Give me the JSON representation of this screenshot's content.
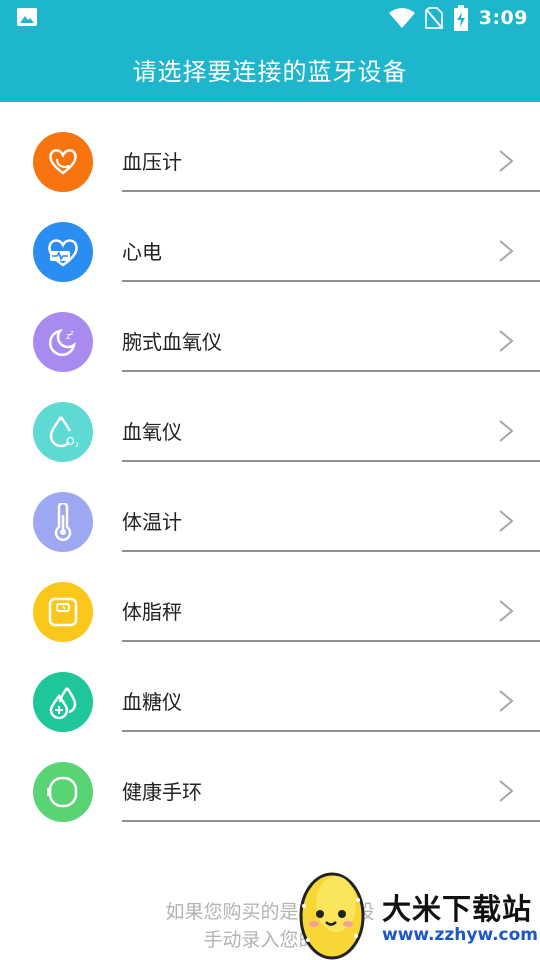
{
  "status_bar": {
    "time": "3:09",
    "icons": [
      "image-icon",
      "wifi-icon",
      "no-sim-icon",
      "battery-charging-icon"
    ]
  },
  "header": {
    "title": "请选择要连接的蓝牙设备"
  },
  "devices": [
    {
      "label": "血压计",
      "icon": "blood-pressure-icon",
      "color": "#f7740f"
    },
    {
      "label": "心电",
      "icon": "ecg-heart-icon",
      "color": "#2a8df2"
    },
    {
      "label": "腕式血氧仪",
      "icon": "wrist-oximeter-icon",
      "color": "#a98bf0"
    },
    {
      "label": "血氧仪",
      "icon": "oxygen-drop-icon",
      "color": "#5ed9d4"
    },
    {
      "label": "体温计",
      "icon": "thermometer-icon",
      "color": "#9ea7f2"
    },
    {
      "label": "体脂秤",
      "icon": "scale-icon",
      "color": "#fbc71a"
    },
    {
      "label": "血糖仪",
      "icon": "glucose-drop-icon",
      "color": "#1ec69a"
    },
    {
      "label": "健康手环",
      "icon": "wristband-icon",
      "color": "#59d474"
    }
  ],
  "footer": {
    "line1": "如果您购买的是非蓝牙设",
    "line2": "手动录入您的测"
  },
  "watermark": {
    "title": "大米下载站",
    "url": "www.zzhyw.com"
  }
}
